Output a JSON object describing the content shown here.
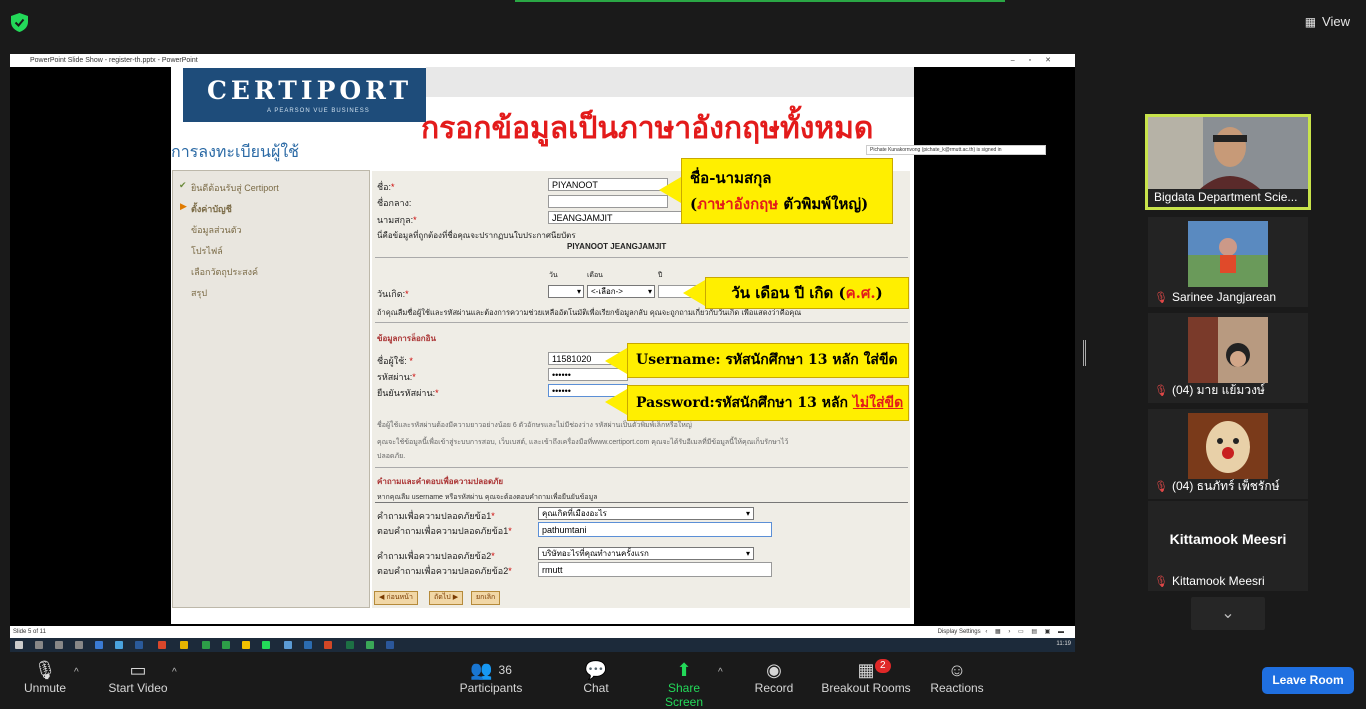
{
  "top": {
    "view_label": "View"
  },
  "ppt": {
    "window_title": "PowerPoint Slide Show  -  register-th.pptx - PowerPoint",
    "slide_status": "Slide 5 of 11",
    "display_settings": "Display Settings",
    "signed_in": "Pichate Kunakornvong (pichate_k@rmutt.ac.th) is signed in",
    "clock": "11:19"
  },
  "slide": {
    "logo_word": "CERTIPORT",
    "logo_sub": "A PEARSON VUE BUSINESS",
    "big_title": "กรอกข้อมูลเป็นภาษาอังกฤษทั้งหมด",
    "reg_title": "การลงทะเบียนผู้ใช้",
    "sidebar": [
      "ยินดีต้อนรับสู่ Certiport",
      "ตั้งค่าบัญชี",
      "ข้อมูลส่วนตัว",
      "โปรไฟล์",
      "เลือกวัตถุประสงค์",
      "สรุป"
    ],
    "form": {
      "first_label": "ชื่อ:",
      "first_value": "PIYANOOT",
      "middle_label": "ชื่อกลาง:",
      "last_label": "นามสกุล:",
      "last_value": "JEANGJAMJIT",
      "cert_note": "นี่คือข้อมูลที่ถูกต้องที่ชื่อคุณจะปรากฏบนใบประกาศนียบัตร",
      "cert_name": "PIYANOOT JEANGJAMJIT",
      "day_col": "วัน",
      "month_col": "เดือน",
      "year_col": "ปี",
      "dob_label": "วันเกิด:",
      "month_select": "<-เลือก->",
      "dob_note": "ถ้าคุณลืมชื่อผู้ใช้และรหัสผ่านและต้องการความช่วยเหลืออัตโนมัติเพื่อเรียกข้อมูลกลับ คุณจะถูกถามเกี่ยวกับวันเกิด เพื่อแสดงว่าคือคุณ",
      "login_head": "ข้อมูลการล็อกอิน",
      "user_label": "ชื่อผู้ใช้:",
      "user_value": "11581020",
      "pass_label": "รหัสผ่าน:",
      "pass_value": "••••••",
      "confirm_label": "ยืนยันรหัสผ่าน:",
      "confirm_value": "••••••",
      "pw_note": "ชื่อผู้ใช้และรหัสผ่านต้องมีความยาวอย่างน้อย 6 ตัวอักษรและไม่มีช่องว่าง รหัสผ่านเป็นตัวพิมพ์เล็กหรือใหญ่",
      "use_note": "คุณจะใช้ข้อมูลนี้เพื่อเข้าสู่ระบบการสอบ, เว็บเบสต์, และเข้าถึงเครื่องมือที่www.certiport.com คุณจะได้รับอีเมลที่มีข้อมูลนี้ให้คุณเก็บรักษาไว้",
      "use_note2": "ปลอดภัย.",
      "sec_head": "คำถามและคำตอบเพื่อความปลอดภัย",
      "sec_note": "หากคุณลืม username หรือรหัสผ่าน คุณจะต้องตอบคำถามเพื่อยืนยันข้อมูล",
      "q1_label": "คำถามเพื่อความปลอดภัยข้อ1",
      "q1_value": "คุณเกิดที่เมืองอะไร",
      "a1_label": "ตอบคำถามเพื่อความปลอดภัยข้อ1",
      "a1_value": "pathumtani",
      "q2_label": "คำถามเพื่อความปลอดภัยข้อ2",
      "q2_value": "บริษัทอะไรที่คุณทำงานครั้งแรก",
      "a2_label": "ตอบคำถามเพื่อความปลอดภัยข้อ2",
      "a2_value": "rmutt",
      "btn_prev": "ก่อนหน้า",
      "btn_next": "ถัดไป",
      "btn_cancel": "ยกเลิก"
    },
    "callouts": {
      "name_line1": "ชื่อ-นามสกุล",
      "name_line2_red": "ภาษาอังกฤษ",
      "name_line2_rest": " ตัวพิมพ์ใหญ่)",
      "dob_text": "วัน เดือน ปี เกิด (",
      "dob_red": "ค.ศ.",
      "dob_close": ")",
      "user_text": "Username: รหัสนักศึกษา 13 หลัก ใส่ขีด",
      "pass_text": "Password:รหัสนักศึกษา 13 หลัก ",
      "pass_red": "ไม่ใส่ขีด"
    }
  },
  "participants": [
    {
      "name": "Bigdata Department Scie...",
      "muted": false
    },
    {
      "name": "Sarinee Jangjarean",
      "muted": true
    },
    {
      "name": "(04) มาย แย้มวงษ์",
      "muted": true
    },
    {
      "name": "(04) ธนภัทร์ เพ็ชรักษ์",
      "muted": true
    },
    {
      "name": "Kittamook Meesri",
      "muted": true,
      "display_name": "Kittamook Meesri"
    }
  ],
  "toolbar": {
    "unmute": "Unmute",
    "start_video": "Start Video",
    "participants": "Participants",
    "participants_count": "36",
    "chat": "Chat",
    "share_screen": "Share Screen",
    "record": "Record",
    "breakout": "Breakout Rooms",
    "breakout_badge": "2",
    "reactions": "Reactions",
    "leave": "Leave Room"
  },
  "colors": {
    "accent_green": "#23d959",
    "leave_blue": "#1f6fe0",
    "callout_yellow": "#ffef00",
    "title_red": "#e31b1b"
  }
}
